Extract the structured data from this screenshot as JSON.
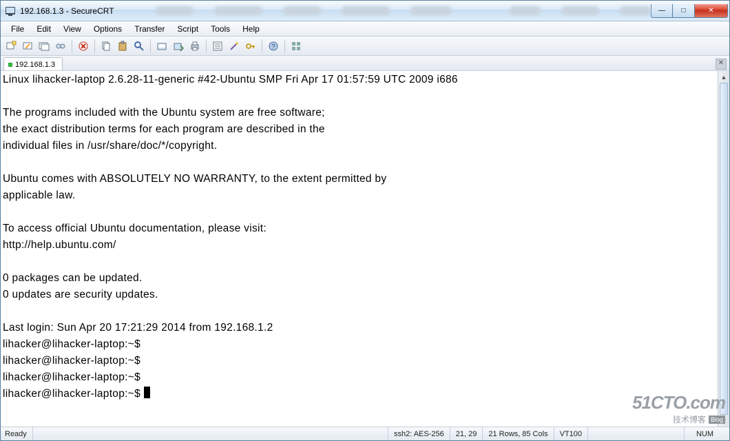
{
  "titlebar": {
    "title": "192.168.1.3 - SecureCRT"
  },
  "winbtns": {
    "min": "—",
    "max": "□",
    "close": "✕"
  },
  "menu": {
    "file": "File",
    "edit": "Edit",
    "view": "View",
    "options": "Options",
    "transfer": "Transfer",
    "script": "Script",
    "tools": "Tools",
    "help": "Help"
  },
  "icons": {
    "new": "new-session-icon",
    "open": "open-icon",
    "host": "host-icon",
    "network": "network-icon",
    "del": "delete-icon",
    "copy": "copy-icon",
    "paste": "paste-icon",
    "find": "find-icon",
    "disconnect": "disconnect-icon",
    "reconnect": "reconnect-icon",
    "print": "print-icon",
    "props": "properties-icon",
    "wand": "wand-icon",
    "key": "key-icon",
    "help": "help-icon",
    "grid": "grid-icon"
  },
  "tab": {
    "label": "192.168.1.3"
  },
  "terminal": {
    "l1": "Linux lihacker-laptop 2.6.28-11-generic #42-Ubuntu SMP Fri Apr 17 01:57:59 UTC 2009 i686",
    "l2": "",
    "l3": "The programs included with the Ubuntu system are free software;",
    "l4": "the exact distribution terms for each program are described in the",
    "l5": "individual files in /usr/share/doc/*/copyright.",
    "l6": "",
    "l7": "Ubuntu comes with ABSOLUTELY NO WARRANTY, to the extent permitted by",
    "l8": "applicable law.",
    "l9": "",
    "l10": "To access official Ubuntu documentation, please visit:",
    "l11": "http://help.ubuntu.com/",
    "l12": "",
    "l13": "0 packages can be updated.",
    "l14": "0 updates are security updates.",
    "l15": "",
    "l16": "Last login: Sun Apr 20 17:21:29 2014 from 192.168.1.2",
    "l17": "lihacker@lihacker-laptop:~$",
    "l18": "lihacker@lihacker-laptop:~$",
    "l19": "lihacker@lihacker-laptop:~$",
    "l20": "lihacker@lihacker-laptop:~$ "
  },
  "status": {
    "ready": "Ready",
    "conn": "ssh2: AES-256",
    "pos": "21,  29",
    "dims": "21 Rows, 85 Cols",
    "term": "VT100",
    "num": "NUM"
  },
  "watermark": {
    "l1": "51CTO.com",
    "l2": "技术博客",
    "tag": "Blog"
  },
  "colors": {
    "accent": "#c22e19"
  }
}
